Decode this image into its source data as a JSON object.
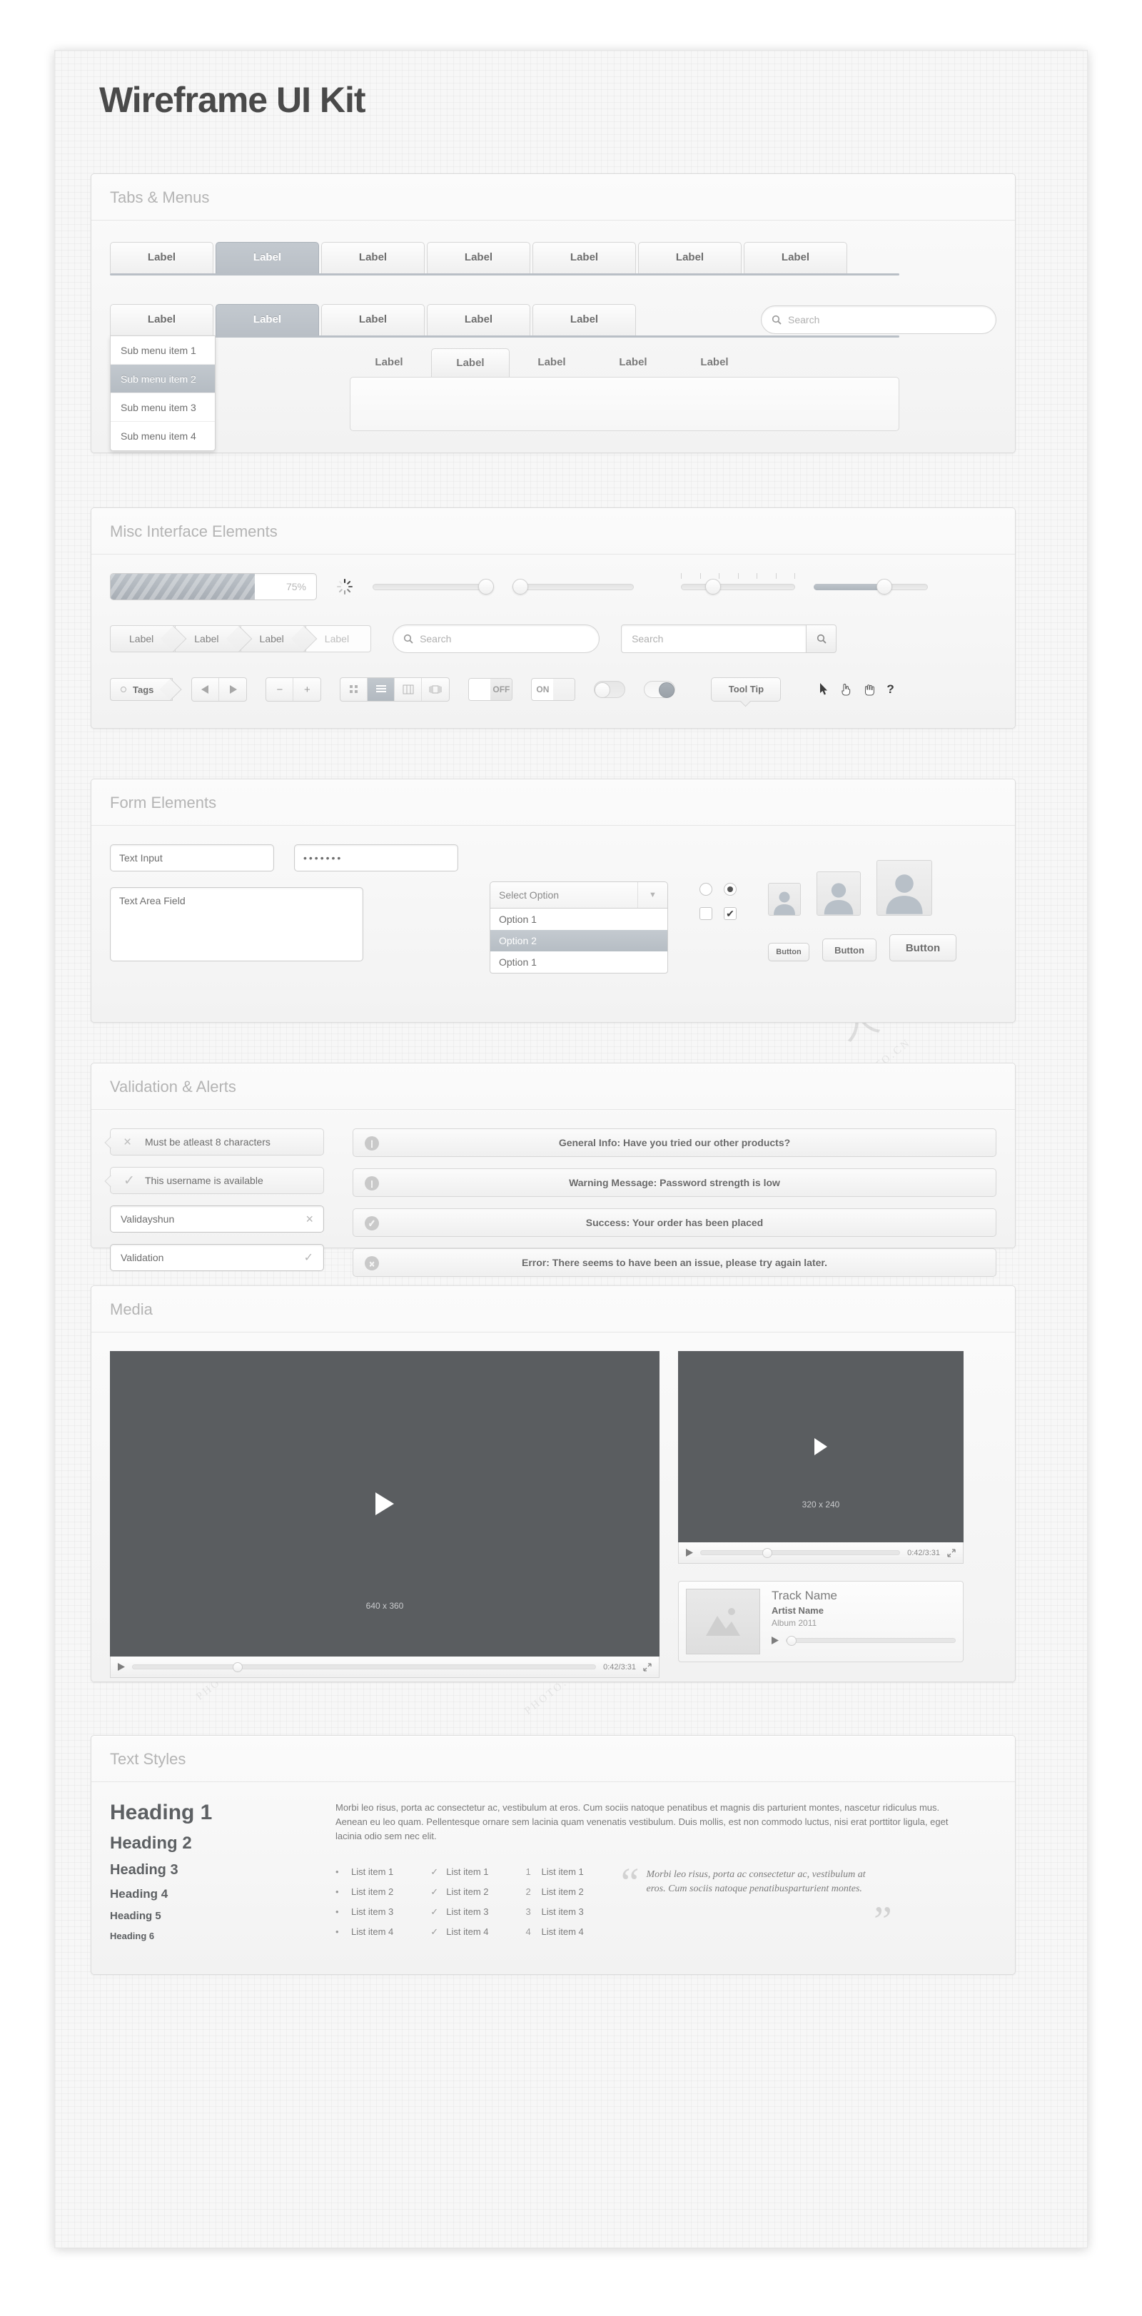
{
  "page": {
    "title": "Wireframe UI Kit"
  },
  "sections": {
    "tabs_menus": {
      "title": "Tabs & Menus"
    },
    "misc": {
      "title": "Misc Interface Elements"
    },
    "form": {
      "title": "Form Elements"
    },
    "validation": {
      "title": "Validation & Alerts"
    },
    "media": {
      "title": "Media"
    },
    "text_styles": {
      "title": "Text Styles"
    }
  },
  "tabs": {
    "row1": [
      {
        "label": "Label",
        "active": false
      },
      {
        "label": "Label",
        "active": true
      },
      {
        "label": "Label",
        "active": false
      },
      {
        "label": "Label",
        "active": false
      },
      {
        "label": "Label",
        "active": false
      },
      {
        "label": "Label",
        "active": false
      },
      {
        "label": "Label",
        "active": false
      }
    ],
    "row2": [
      {
        "label": "Label",
        "active": false
      },
      {
        "label": "Label",
        "active": true
      },
      {
        "label": "Label",
        "active": false
      },
      {
        "label": "Label",
        "active": false
      },
      {
        "label": "Label",
        "active": false
      }
    ],
    "row2_search_placeholder": "Search",
    "submenu": [
      {
        "label": "Sub menu item 1",
        "active": false
      },
      {
        "label": "Sub menu item 2",
        "active": true
      },
      {
        "label": "Sub menu item 3",
        "active": false
      },
      {
        "label": "Sub menu item 4",
        "active": false
      }
    ],
    "row3": [
      {
        "label": "Label",
        "active": false
      },
      {
        "label": "Label",
        "active": true
      },
      {
        "label": "Label",
        "active": false
      },
      {
        "label": "Label",
        "active": false
      },
      {
        "label": "Label",
        "active": false
      }
    ]
  },
  "misc": {
    "progress_value": "75%",
    "progress_percent": 70,
    "search_round_placeholder": "Search",
    "search_square_placeholder": "Search",
    "breadcrumbs": [
      {
        "label": "Label",
        "current": false
      },
      {
        "label": "Label",
        "current": false
      },
      {
        "label": "Label",
        "current": false
      },
      {
        "label": "Label",
        "current": true
      }
    ],
    "tag_label": "Tags",
    "stepper_minus": "−",
    "stepper_plus": "+",
    "view_modes": [
      {
        "name": "grid-view",
        "glyph": "∷",
        "selected": false
      },
      {
        "name": "list-view",
        "glyph": "≡",
        "selected": true
      },
      {
        "name": "column-view",
        "glyph": "‖",
        "selected": false
      },
      {
        "name": "cover-view",
        "glyph": "▣",
        "selected": false
      }
    ],
    "toggle_off_label": "OFF",
    "toggle_on_label": "ON",
    "tooltip_label": "Tool Tip",
    "cursors": [
      "arrow-cursor",
      "pointer-hand-cursor",
      "open-hand-cursor",
      "help-cursor"
    ]
  },
  "form": {
    "text_input_value": "Text Input",
    "password_value": "•••••••",
    "textarea_value": "Text Area Field",
    "select_label": "Select Option",
    "select_options": [
      {
        "label": "Option 1",
        "selected": false
      },
      {
        "label": "Option 2",
        "selected": true
      },
      {
        "label": "Option 1",
        "selected": false
      }
    ],
    "buttons": [
      {
        "label": "Button",
        "size": "small"
      },
      {
        "label": "Button",
        "size": "medium"
      },
      {
        "label": "Button",
        "size": "large"
      }
    ]
  },
  "validation": {
    "tips": [
      {
        "icon": "×",
        "text": "Must be atleast 8 characters",
        "name": "error-tip"
      },
      {
        "icon": "✓",
        "text": "This username is available",
        "name": "success-tip"
      }
    ],
    "fields": [
      {
        "value": "Validayshun",
        "icon": "×",
        "name": "invalid-field"
      },
      {
        "value": "Validation",
        "icon": "✓",
        "name": "valid-field"
      }
    ],
    "alerts": [
      {
        "icon": "i",
        "text": "General Info: Have you tried our other products?",
        "name": "info-alert"
      },
      {
        "icon": "!",
        "text": "Warning Message: Password strength is low",
        "name": "warning-alert"
      },
      {
        "icon": "✓",
        "text": "Success: Your order has been placed",
        "name": "success-alert"
      },
      {
        "icon": "×",
        "text": "Error: There seems to have been an issue, please try again later.",
        "name": "error-alert"
      }
    ]
  },
  "media": {
    "video_large_size": "640 x 360",
    "video_large_time": "0:42/3:31",
    "video_small_size": "320 x 240",
    "video_small_time": "0:42/3:31",
    "track": {
      "name": "Track Name",
      "artist": "Artist Name",
      "album": "Album 2011"
    }
  },
  "text_styles": {
    "headings": [
      {
        "label": "Heading 1",
        "size": 30
      },
      {
        "label": "Heading 2",
        "size": 24
      },
      {
        "label": "Heading 3",
        "size": 20
      },
      {
        "label": "Heading 4",
        "size": 17
      },
      {
        "label": "Heading 5",
        "size": 15
      },
      {
        "label": "Heading 6",
        "size": 13
      }
    ],
    "paragraph": "Morbi leo risus, porta ac consectetur ac, vestibulum at eros. Cum sociis natoque penatibus et magnis dis parturient montes, nascetur ridiculus mus. Aenean eu leo quam. Pellentesque ornare sem lacinia quam venenatis vestibulum. Duis mollis, est non commodo luctus, nisi erat porttitor ligula, eget lacinia odio sem nec elit.",
    "bullet_list": [
      "List item 1",
      "List item 2",
      "List item 3",
      "List item 4"
    ],
    "check_list": [
      "List item 1",
      "List item 2",
      "List item 3",
      "List item 4"
    ],
    "number_list": [
      "List item 1",
      "List item 2",
      "List item 3",
      "List item 4"
    ],
    "quote": "Morbi leo risus, porta ac consectetur ac, vestibulum at eros. Cum sociis natoque penatibusparturient montes."
  },
  "colors": {
    "accent": "#b9bfc6",
    "text": "#6d6d6d",
    "panel_title": "#b4b4b4",
    "canvas": "#f7f7f7"
  }
}
